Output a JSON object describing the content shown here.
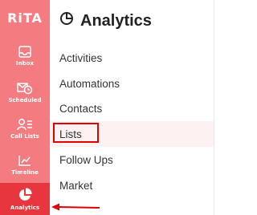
{
  "app": {
    "logo_text": "RiTA"
  },
  "sidebar": {
    "items": [
      {
        "label": "Inbox",
        "icon": "inbox-icon"
      },
      {
        "label": "Scheduled",
        "icon": "scheduled-mail-icon"
      },
      {
        "label": "Call Lists",
        "icon": "call-list-icon"
      },
      {
        "label": "Timeline",
        "icon": "timeline-icon"
      },
      {
        "label": "Analytics",
        "icon": "analytics-pie-icon",
        "active": true
      }
    ]
  },
  "panel": {
    "title": "Analytics",
    "title_icon": "pie-chart-icon",
    "items": [
      {
        "label": "Activities"
      },
      {
        "label": "Automations"
      },
      {
        "label": "Contacts"
      },
      {
        "label": "Lists",
        "selected": true,
        "highlighted": true
      },
      {
        "label": "Follow Ups"
      },
      {
        "label": "Market"
      }
    ]
  },
  "colors": {
    "sidebar_bg": "#f47c81",
    "sidebar_active": "#e8363f",
    "highlight": "#e00000",
    "selected_bg": "#fdf1f1"
  }
}
